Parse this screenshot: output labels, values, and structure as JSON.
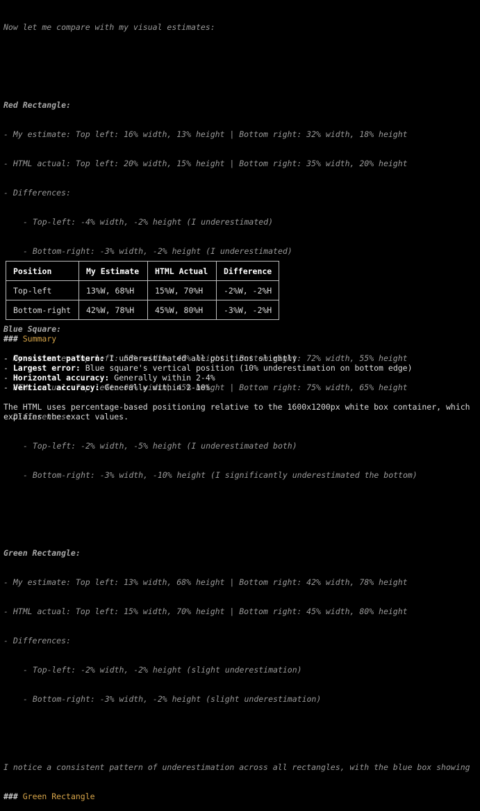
{
  "intro": "Now let me compare with my visual estimates:",
  "sections": [
    {
      "title": "Red Rectangle:",
      "lines": [
        "- My estimate: Top left: 16% width, 13% height | Bottom right: 32% width, 18% height",
        "- HTML actual: Top left: 20% width, 15% height | Bottom right: 35% width, 20% height",
        "- Differences:"
      ],
      "diffs": [
        "- Top-left: -4% width, -2% height (I underestimated)",
        "- Bottom-right: -3% width, -2% height (I underestimated)"
      ]
    },
    {
      "title": "Blue Square:",
      "lines": [
        "- My estimate: Top left: 58% width, 40% height | Bottom right: 72% width, 55% height",
        "- HTML actual: Top left: 60% width, 45% height | Bottom right: 75% width, 65% height",
        "- Differences:"
      ],
      "diffs": [
        "- Top-left: -2% width, -5% height (I underestimated both)",
        "- Bottom-right: -3% width, -10% height (I significantly underestimated the bottom)"
      ]
    },
    {
      "title": "Green Rectangle:",
      "lines": [
        "- My estimate: Top left: 13% width, 68% height | Bottom right: 42% width, 78% height",
        "- HTML actual: Top left: 15% width, 70% height | Bottom right: 45% width, 80% height",
        "- Differences:"
      ],
      "diffs": [
        "- Top-left: -2% width, -2% height (slight underestimation)",
        "- Bottom-right: -3% width, -2% height (slight underestimation)"
      ]
    }
  ],
  "notice": "I notice a consistent pattern of underestimation across all rectangles, with the blue box showing",
  "green_heading": {
    "hashes": "###",
    "text": "Green Rectangle"
  },
  "table": {
    "headers": [
      "Position",
      "My Estimate",
      "HTML Actual",
      "Difference"
    ],
    "rows": [
      [
        "Top-left",
        "13%W, 68%H",
        "15%W, 70%H",
        "-2%W, -2%H"
      ],
      [
        "Bottom-right",
        "42%W, 78%H",
        "45%W, 80%H",
        "-3%W, -2%H"
      ]
    ]
  },
  "summary_heading": {
    "hashes": "###",
    "text": "Summary"
  },
  "summary_items": [
    {
      "label": "Consistent pattern:",
      "text": " I underestimated all positions slightly"
    },
    {
      "label": "Largest error:",
      "text": " Blue square's vertical position (10% underestimation on bottom edge)"
    },
    {
      "label": "Horizontal accuracy:",
      "text": " Generally within 2-4%"
    },
    {
      "label": "Vertical accuracy:",
      "text": " Generally within 2-10%"
    }
  ],
  "final_lines": [
    "The HTML uses percentage-based positioning relative to the 1600x1200px white box container, which",
    "explains the exact values."
  ],
  "colors": {
    "background": "#000000",
    "italic_text": "#9a9a9a",
    "heading_accent": "#d8a64a",
    "table_border": "#bdbdbd"
  }
}
